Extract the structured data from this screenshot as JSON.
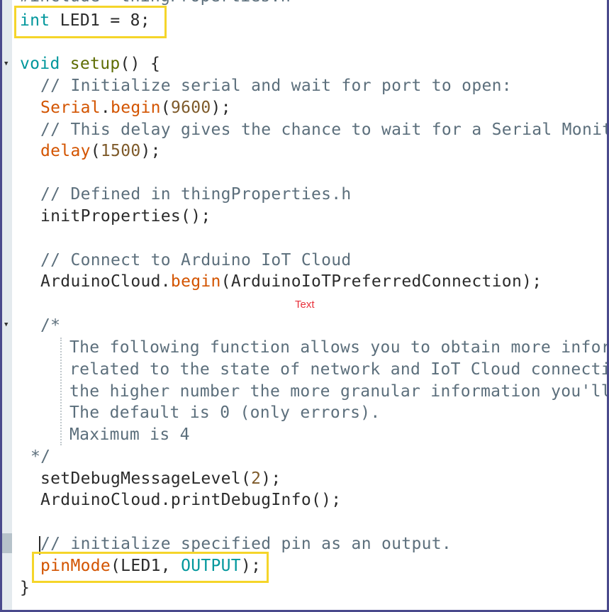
{
  "editor": {
    "lines": {
      "l0": "#include \"thingProperties.h\"",
      "l1_kw": "int",
      "l1_rest": " LED1 = 8;",
      "l2_kw": "void",
      "l2_fn": "setup",
      "l2_rest": "() {",
      "l3": "// Initialize serial and wait for port to open:",
      "l4_red": "Serial",
      "l4_dot": ".",
      "l4_fn": "begin",
      "l4_open": "(",
      "l4_num": "9600",
      "l4_close": ");",
      "l5": "// This delay gives the chance to wait for a Serial Monit",
      "l6_red": "delay",
      "l6_open": "(",
      "l6_num": "1500",
      "l6_close": ");",
      "l7": "// Defined in thingProperties.h",
      "l8": "initProperties();",
      "l9": "// Connect to Arduino IoT Cloud",
      "l10_a": "ArduinoCloud.",
      "l10_red": "begin",
      "l10_b": "(ArduinoIoTPreferredConnection);",
      "l11": "/*",
      "l12": "The following function allows you to obtain more infor",
      "l13": "related to the state of network and IoT Cloud connecti",
      "l14": "the higher number the more granular information you'll",
      "l15": "The default is 0 (only errors).",
      "l16": "Maximum is 4",
      "l17": "*/",
      "l18_a": "setDebugMessageLevel(",
      "l18_num": "2",
      "l18_b": ");",
      "l19": "ArduinoCloud.printDebugInfo();",
      "l20": "// initialize specified pin as an output.",
      "l21_red": "pinMode",
      "l21_a": "(LED1, ",
      "l21_kw": "OUTPUT",
      "l21_b": ");",
      "l22": "}"
    },
    "fold_icon": "fold-triangle-icon"
  },
  "annotation": {
    "text": "Text"
  },
  "colors": {
    "keyword": "#00979c",
    "function": "#5e6d03",
    "builtin": "#d35400",
    "number": "#7e5a2a",
    "comment": "#5c6f7c",
    "highlight": "#f5d52a",
    "annotation": "#e8303a",
    "frame": "#4a4a8c"
  }
}
